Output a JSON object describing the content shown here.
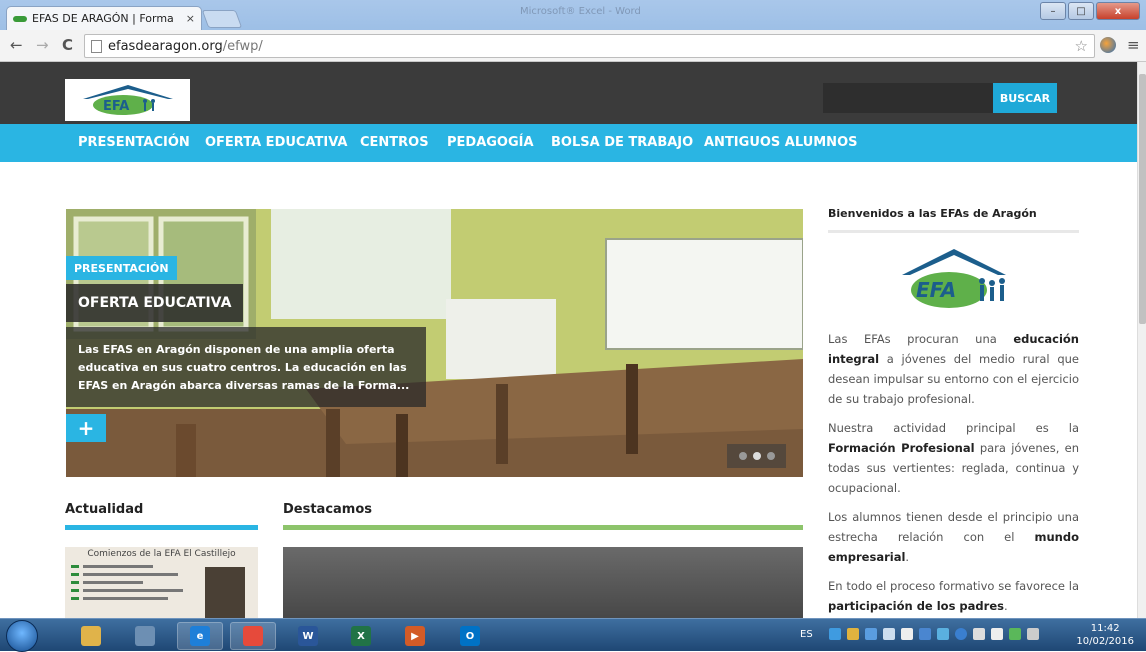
{
  "browser": {
    "tab_title": "EFAS DE ARAGÓN | Forma",
    "tab_close": "×",
    "window_title": "Microsoft® Excel - Word",
    "url_host": "efasdearagon.org",
    "url_path": "/efwp/",
    "back_icon": "←",
    "forward_icon": "→",
    "reload_icon": "C",
    "star_icon": "☆",
    "menu_icon": "≡",
    "win_minimize": "–",
    "win_maximize": "□",
    "win_close": "x"
  },
  "site": {
    "search_button": "BUSCAR",
    "nav": [
      "PRESENTACIÓN",
      "OFERTA EDUCATIVA",
      "CENTROS",
      "PEDAGOGÍA",
      "BOLSA DE TRABAJO",
      "ANTIGUOS ALUMNOS"
    ],
    "logo_text": "EFA",
    "hero": {
      "label": "PRESENTACIÓN",
      "title": "OFERTA EDUCATIVA",
      "excerpt": "Las EFAS en Aragón disponen de una amplia oferta educativa en sus cuatro centros. La educación en las EFAS en Aragón abarca diversas ramas de la Forma...",
      "plus": "+",
      "slides": 3,
      "active_slide": 2
    },
    "sections": {
      "news_title": "Actualidad",
      "featured_title": "Destacamos",
      "news_thumb_caption": "Comienzos de la EFA El Castillejo"
    },
    "sidebar": {
      "title": "Bienvenidos a las EFAs de Aragón",
      "p1_a": "Las EFAs procuran una ",
      "p1_b": "educación integral",
      "p1_c": " a jóvenes del medio rural que desean impulsar su entorno con el ejercicio de su trabajo profesional.",
      "p2_a": "Nuestra actividad principal es la ",
      "p2_b": "Formación Profesional",
      "p2_c": " para jóvenes, en todas sus vertientes: reglada, continua y ocupacional.",
      "p3_a": "Los alumnos tienen desde el principio una estrecha relación con el ",
      "p3_b": "mundo empresarial",
      "p3_c": ".",
      "p4_a": "En todo el proceso formativo se favorece la ",
      "p4_b": "participación de los padres",
      "p4_c": "."
    },
    "colors": {
      "header_dark": "#3b3b3b",
      "accent_blue": "#2ab5e3",
      "accent_green": "#8dc46b"
    }
  },
  "taskbar": {
    "apps": [
      {
        "name": "file-explorer",
        "glyph": "",
        "color": "#e0b34a"
      },
      {
        "name": "photo-app",
        "glyph": "",
        "color": "#6d8fb3"
      },
      {
        "name": "internet-explorer",
        "glyph": "e",
        "color": "#1e7fd8"
      },
      {
        "name": "chrome",
        "glyph": "",
        "color": "#e64a3b"
      },
      {
        "name": "word",
        "glyph": "W",
        "color": "#2a5699"
      },
      {
        "name": "excel",
        "glyph": "X",
        "color": "#217346"
      },
      {
        "name": "media",
        "glyph": "▶",
        "color": "#d35b27"
      },
      {
        "name": "outlook",
        "glyph": "O",
        "color": "#0072c6"
      }
    ],
    "language": "ES",
    "time": "11:42",
    "date": "10/02/2016"
  }
}
